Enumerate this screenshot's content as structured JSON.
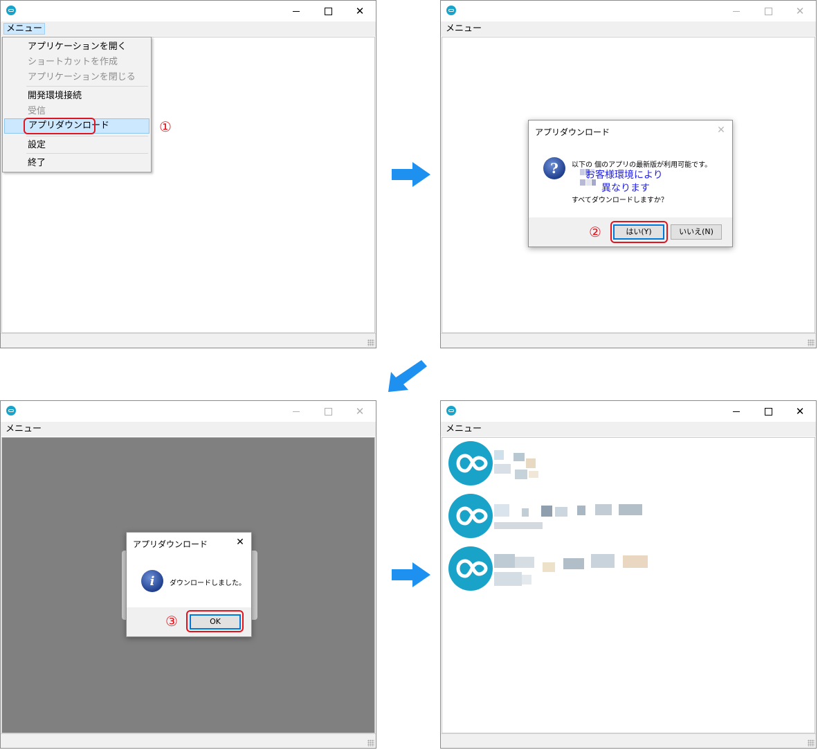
{
  "menu": {
    "label": "メニュー",
    "items": [
      {
        "label": "アプリケーションを開く",
        "disabled": false
      },
      {
        "label": "ショートカットを作成",
        "disabled": true
      },
      {
        "label": "アプリケーションを閉じる",
        "disabled": true
      },
      {
        "label": "開発環境接続",
        "disabled": false
      },
      {
        "label": "受信",
        "disabled": true
      },
      {
        "label": "アプリダウンロード",
        "disabled": false,
        "selected": true
      },
      {
        "label": "設定",
        "disabled": false
      },
      {
        "label": "終了",
        "disabled": false
      }
    ]
  },
  "steps": {
    "one": "①",
    "two": "②",
    "three": "③"
  },
  "confirm_dialog": {
    "title": "アプリダウンロード",
    "line1": "以下の 個のアプリの最新版が利用可能です。",
    "overlay1": "お客様環境により",
    "overlay2": "異なります",
    "line_last": "すべてダウンロードしますか？",
    "yes_label": "はい(Y)",
    "no_label": "いいえ(N)"
  },
  "done_dialog": {
    "title": "アプリダウンロード",
    "message": "ダウンロードしました。",
    "ok_label": "OK"
  },
  "icons": {
    "question": "?",
    "info": "i",
    "close": "✕"
  },
  "colors": {
    "accent": "#1aa3c8",
    "highlight": "#e0141e",
    "arrow": "#1e90f0",
    "overlay_text": "#1f1fe6"
  }
}
